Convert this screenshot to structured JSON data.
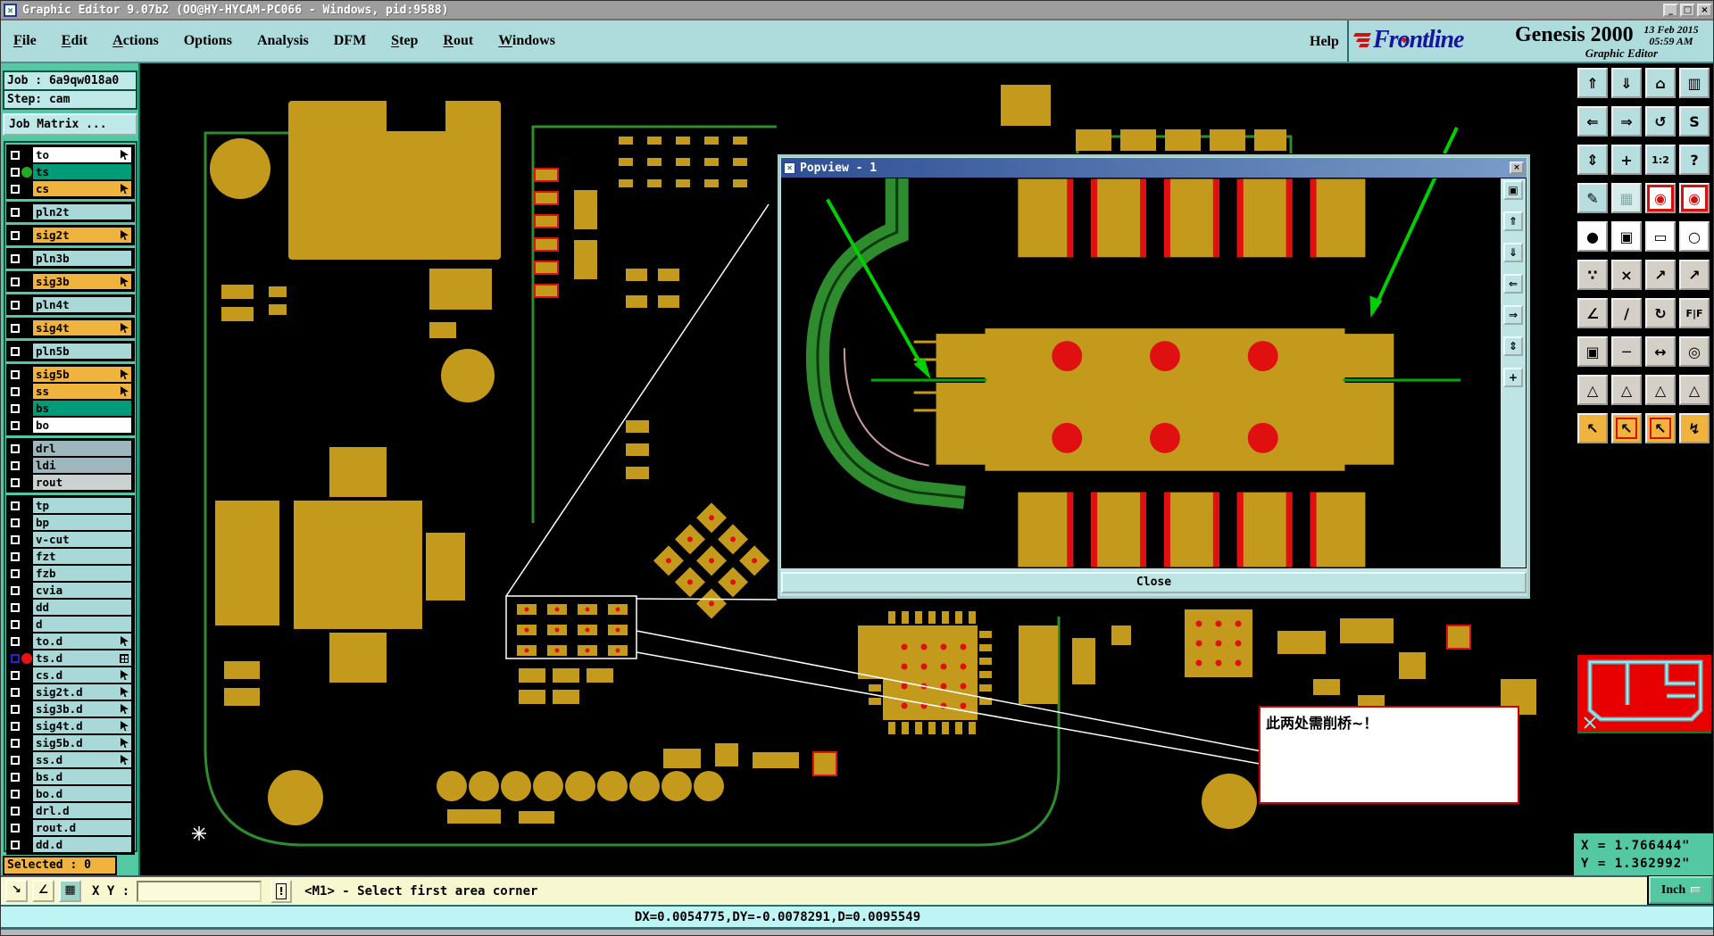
{
  "window": {
    "title": "Graphic Editor 9.07b2 (OO@HY-HYCAM-PC066 - Windows, pid:9588)",
    "controls": [
      {
        "name": "minimize-button",
        "glyph": "_"
      },
      {
        "name": "maximize-button",
        "glyph": "□"
      },
      {
        "name": "close-button",
        "glyph": "×"
      }
    ]
  },
  "menu": {
    "items": [
      {
        "label": "File",
        "underline": 0
      },
      {
        "label": "Edit",
        "underline": 0
      },
      {
        "label": "Actions",
        "underline": 0
      },
      {
        "label": "Options",
        "underline": -1
      },
      {
        "label": "Analysis",
        "underline": -1
      },
      {
        "label": "DFM",
        "underline": -1
      },
      {
        "label": "Step",
        "underline": 0
      },
      {
        "label": "Rout",
        "underline": 0
      },
      {
        "label": "Windows",
        "underline": 0
      }
    ],
    "help": "Help"
  },
  "brand": {
    "logo": "Frontline",
    "product": "Genesis 2000",
    "date": "13 Feb 2015",
    "time": "05:59 AM",
    "subtitle": "Graphic Editor"
  },
  "sidebar": {
    "job_label": "Job : 6a9qw018a0",
    "step_label": "Step: cam",
    "matrix_button": "Job Matrix ...",
    "selected_label": "Selected : 0",
    "layer_groups": [
      [
        {
          "name": "to",
          "bg": "w",
          "glyph": "arrow"
        },
        {
          "name": "ts",
          "bg": "g",
          "dot": "green"
        },
        {
          "name": "cs",
          "bg": "o",
          "glyph": "arrow"
        }
      ],
      [
        {
          "name": "pln2t",
          "bg": "b"
        }
      ],
      [
        {
          "name": "sig2t",
          "bg": "o",
          "glyph": "arrow"
        }
      ],
      [
        {
          "name": "pln3b",
          "bg": "b"
        }
      ],
      [
        {
          "name": "sig3b",
          "bg": "o",
          "glyph": "arrow"
        }
      ],
      [
        {
          "name": "pln4t",
          "bg": "b"
        }
      ],
      [
        {
          "name": "sig4t",
          "bg": "o",
          "glyph": "arrow"
        }
      ],
      [
        {
          "name": "pln5b",
          "bg": "b"
        }
      ],
      [
        {
          "name": "sig5b",
          "bg": "o",
          "glyph": "arrow"
        },
        {
          "name": "ss",
          "bg": "o",
          "glyph": "arrow"
        },
        {
          "name": "bs",
          "bg": "g"
        },
        {
          "name": "bo",
          "bg": "w"
        }
      ],
      [
        {
          "name": "drl",
          "bg": "s"
        },
        {
          "name": "ldi",
          "bg": "s"
        },
        {
          "name": "rout",
          "bg": "lg"
        }
      ],
      [
        {
          "name": "tp",
          "bg": "b"
        },
        {
          "name": "bp",
          "bg": "b"
        },
        {
          "name": "v-cut",
          "bg": "b"
        },
        {
          "name": "fzt",
          "bg": "b"
        },
        {
          "name": "fzb",
          "bg": "b"
        },
        {
          "name": "cvia",
          "bg": "b"
        },
        {
          "name": "dd",
          "bg": "b"
        },
        {
          "name": "d",
          "bg": "b"
        },
        {
          "name": "to.d",
          "bg": "b",
          "glyph": "arrow"
        },
        {
          "name": "ts.d",
          "bg": "b",
          "dot": "red",
          "glyph": "grid",
          "selected": true
        },
        {
          "name": "cs.d",
          "bg": "b",
          "glyph": "arrow"
        },
        {
          "name": "sig2t.d",
          "bg": "b",
          "glyph": "arrow"
        },
        {
          "name": "sig3b.d",
          "bg": "b",
          "glyph": "arrow"
        },
        {
          "name": "sig4t.d",
          "bg": "b",
          "glyph": "arrow"
        },
        {
          "name": "sig5b.d",
          "bg": "b",
          "glyph": "arrow"
        },
        {
          "name": "ss.d",
          "bg": "b",
          "glyph": "arrow"
        },
        {
          "name": "bs.d",
          "bg": "b"
        },
        {
          "name": "bo.d",
          "bg": "b"
        },
        {
          "name": "drl.d",
          "bg": "b"
        },
        {
          "name": "rout.d",
          "bg": "b"
        },
        {
          "name": "dd.d",
          "bg": "b"
        }
      ]
    ]
  },
  "toolbar": {
    "rows": [
      [
        {
          "n": "zoom-in",
          "g": "⇑",
          "bg": "teal"
        },
        {
          "n": "zoom-out",
          "g": "⇓",
          "bg": "teal"
        },
        {
          "n": "home-view",
          "g": "⌂",
          "bg": "teal"
        },
        {
          "n": "split-views",
          "g": "▥",
          "bg": "teal"
        }
      ],
      [
        {
          "n": "previous-view",
          "g": "⇐",
          "bg": "teal"
        },
        {
          "n": "next-view",
          "g": "⇒",
          "bg": "teal"
        },
        {
          "n": "restore-view",
          "g": "↺",
          "bg": "teal"
        },
        {
          "n": "refresh-view",
          "g": "S",
          "bg": "teal"
        }
      ],
      [
        {
          "n": "zoom-fit",
          "g": "⇕",
          "bg": "teal"
        },
        {
          "n": "pan-view",
          "g": "+",
          "bg": "teal"
        },
        {
          "n": "zoom-ratio-1-2",
          "g": "1:2",
          "bg": "teal small"
        },
        {
          "n": "query-mode",
          "g": "?",
          "bg": "teal"
        }
      ],
      [
        {
          "n": "setup-tools",
          "g": "✎",
          "bg": "teal"
        },
        {
          "n": "grid-toggle",
          "g": "▦",
          "bg": "teal2"
        },
        {
          "n": "display-profile-1",
          "g": "◉",
          "bg": "redframe"
        },
        {
          "n": "display-profile-2",
          "g": "◉",
          "bg": "redframe"
        }
      ],
      [
        {
          "n": "select-symbol",
          "g": "●",
          "bg": "white"
        },
        {
          "n": "zoom-area",
          "g": "▣",
          "bg": "white"
        },
        {
          "n": "measure-tool",
          "g": "▭",
          "bg": "white"
        },
        {
          "n": "select-area-filter",
          "g": "○",
          "bg": "white"
        }
      ],
      [
        {
          "n": "select-net",
          "g": "∵",
          "bg": "gray"
        },
        {
          "n": "unselect-all",
          "g": "×",
          "bg": "gray"
        },
        {
          "n": "move-origin",
          "g": "↗",
          "bg": "gray"
        },
        {
          "n": "copy-origin",
          "g": "↗",
          "bg": "gray"
        }
      ],
      [
        {
          "n": "rotate-by-angle",
          "g": "∠",
          "bg": "gray"
        },
        {
          "n": "mirror-axis",
          "g": "/",
          "bg": "gray"
        },
        {
          "n": "rotate-90",
          "g": "↻",
          "bg": "gray"
        },
        {
          "n": "mirror-text",
          "g": "F|F",
          "bg": "gray small"
        }
      ],
      [
        {
          "n": "copy-to-layer",
          "g": "▣",
          "bg": "gray"
        },
        {
          "n": "break-entity",
          "g": "─",
          "bg": "gray"
        },
        {
          "n": "resize-entity",
          "g": "↔",
          "bg": "gray"
        },
        {
          "n": "swap-entities",
          "g": "◎",
          "bg": "gray"
        }
      ],
      [
        {
          "n": "arrow-mode-1",
          "g": "△",
          "bg": "gray red"
        },
        {
          "n": "arrow-mode-2",
          "g": "△",
          "bg": "gray red"
        },
        {
          "n": "arrow-mode-3",
          "g": "△",
          "bg": "gray red"
        },
        {
          "n": "arrow-mode-4",
          "g": "△",
          "bg": "gray red"
        }
      ],
      [
        {
          "n": "select-single",
          "g": "↖",
          "bg": "orange"
        },
        {
          "n": "select-frame",
          "g": "↖",
          "bg": "orange2"
        },
        {
          "n": "select-polygon",
          "g": "↖",
          "bg": "orange2"
        },
        {
          "n": "select-reference",
          "g": "↯",
          "bg": "orange"
        }
      ]
    ]
  },
  "popview": {
    "title": "Popview - 1",
    "close_label": "Close",
    "side_buttons": [
      {
        "n": "popview-detach",
        "g": "▣"
      },
      {
        "n": "popview-zoom-in",
        "g": "⇑"
      },
      {
        "n": "popview-zoom-out",
        "g": "⇓"
      },
      {
        "n": "popview-previous-view",
        "g": "⇐"
      },
      {
        "n": "popview-next-view",
        "g": "⇒"
      },
      {
        "n": "popview-zoom-fit",
        "g": "⇕"
      },
      {
        "n": "popview-pan",
        "g": "+"
      }
    ]
  },
  "annotation": {
    "text": "此两处需削桥~！"
  },
  "bottombar": {
    "buttons": [
      {
        "n": "window-zoom-toggle",
        "g": "↘",
        "bg": ""
      },
      {
        "n": "angle-snap-toggle",
        "g": "∠",
        "bg": ""
      },
      {
        "n": "grid-snap-toggle",
        "g": "▦",
        "bg": "teal"
      }
    ],
    "xy_label": "X Y :",
    "input_value": "",
    "confirm_glyph": "!",
    "message": "<M1> - Select first area corner"
  },
  "coords": {
    "x": "X = 1.766444\"",
    "y": "Y = 1.362992\"",
    "units": "Inch"
  },
  "delta_bar": {
    "text": "DX=0.0054775,DY=-0.0078291,D=0.0095549"
  },
  "colors": {
    "chrome_teal": "#aedcdc",
    "sidebar_teal": "#53c8a2",
    "copper": "#c49a1d",
    "pad_red": "#e01010",
    "outline_green": "#2e8b2e",
    "arrow_green": "#00d000",
    "layer_orange": "#f0b33e",
    "layer_blue": "#a9d8d8",
    "layer_green": "#009b78",
    "statusbar_yellow": "#f8f8d0",
    "delta_cyan": "#bff4f4",
    "popview_title_blue": "#2f4f94",
    "annotation_red": "#cc0000"
  }
}
